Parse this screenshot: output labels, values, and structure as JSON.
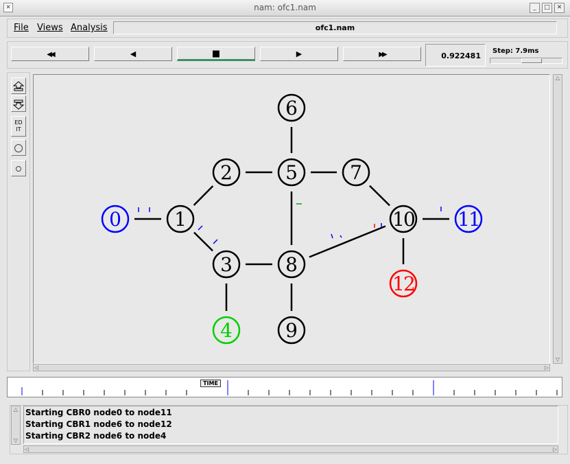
{
  "window": {
    "title": "nam: ofc1.nam"
  },
  "menu": {
    "file": "File",
    "views": "Views",
    "analysis": "Analysis"
  },
  "filename": "ofc1.nam",
  "playback": {
    "rewind_fast": "◀◀",
    "rewind": "◀",
    "stop": "■",
    "play": "▶",
    "forward_fast": "▶▶",
    "active": "stop"
  },
  "sim_time": "0.922481",
  "step": {
    "label": "Step: 7.9ms"
  },
  "tools": {
    "edit": "ED IT"
  },
  "timeline": {
    "marker": "TIME"
  },
  "log": [
    "Starting CBR0 node0 to node11",
    "Starting CBR1 node6 to node12",
    "Starting CBR2 node6 to node4"
  ],
  "colors": {
    "node_default": "#000000",
    "node_blue": "#0000ff",
    "node_red": "#ff0000",
    "node_green": "#00d000",
    "node_fill": "#e8e8e8",
    "stop_indicator": "#3e8e6a"
  },
  "topology": {
    "nodes": [
      {
        "id": "0",
        "color": "blue"
      },
      {
        "id": "1",
        "color": "black"
      },
      {
        "id": "2",
        "color": "black"
      },
      {
        "id": "3",
        "color": "black"
      },
      {
        "id": "4",
        "color": "green"
      },
      {
        "id": "5",
        "color": "black"
      },
      {
        "id": "6",
        "color": "black"
      },
      {
        "id": "7",
        "color": "black"
      },
      {
        "id": "8",
        "color": "black"
      },
      {
        "id": "9",
        "color": "black"
      },
      {
        "id": "10",
        "color": "black"
      },
      {
        "id": "11",
        "color": "blue"
      },
      {
        "id": "12",
        "color": "red"
      }
    ],
    "links": [
      [
        "0",
        "1"
      ],
      [
        "1",
        "2"
      ],
      [
        "1",
        "3"
      ],
      [
        "2",
        "5"
      ],
      [
        "3",
        "8"
      ],
      [
        "3",
        "4"
      ],
      [
        "5",
        "6"
      ],
      [
        "5",
        "7"
      ],
      [
        "5",
        "8"
      ],
      [
        "7",
        "10"
      ],
      [
        "8",
        "9"
      ],
      [
        "8",
        "10"
      ],
      [
        "10",
        "11"
      ],
      [
        "10",
        "12"
      ]
    ]
  }
}
